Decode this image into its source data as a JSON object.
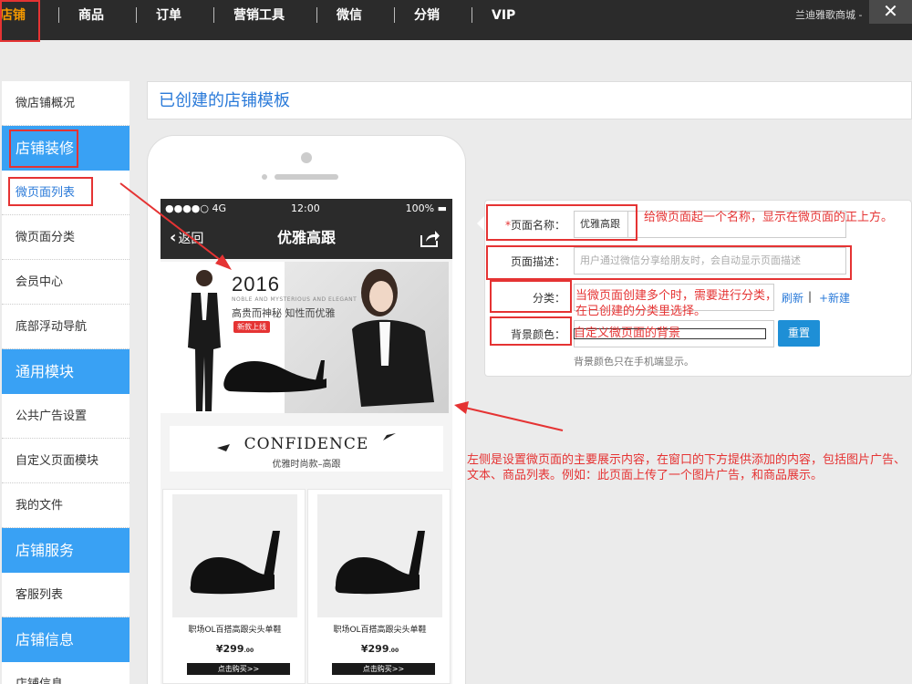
{
  "nav": {
    "items": [
      "店铺",
      "商品",
      "订单",
      "营销工具",
      "微信",
      "分销",
      "VIP"
    ],
    "shop_name": "兰迪雅歌商城 - ",
    "close": "✕"
  },
  "sidebar": {
    "overview": "微店铺概况",
    "sections": [
      {
        "head": "店铺装修",
        "items": [
          "微页面列表",
          "微页面分类",
          "会员中心",
          "底部浮动导航"
        ]
      },
      {
        "head": "通用模块",
        "items": [
          "公共广告设置",
          "自定义页面模块",
          "我的文件"
        ]
      },
      {
        "head": "店铺服务",
        "items": [
          "客服列表"
        ]
      },
      {
        "head": "店铺信息",
        "items": [
          "店铺信息"
        ]
      }
    ]
  },
  "header": {
    "title": "已创建的店铺模板"
  },
  "phone": {
    "status_left": "●●●●○ 4G",
    "status_time": "12:00",
    "status_right": "100% ▬",
    "back_label": "返回",
    "page_title": "优雅高跟",
    "banner": {
      "year": "2016",
      "en": "NOBLE AND MYSTERIOUS AND ELEGANT",
      "cn": "高贵而神秘 知性而优雅",
      "tag": "新款上线"
    },
    "confidence": {
      "en": "CONFIDENCE",
      "cn": "优雅时尚款–高跟"
    },
    "products": [
      {
        "name": "职场OL百搭高跟尖头单鞋",
        "price": "¥299",
        "cents": ".00",
        "buy": "点击购买>>"
      },
      {
        "name": "职场OL百搭高跟尖头单鞋",
        "price": "¥299",
        "cents": ".00",
        "buy": "点击购买>>"
      }
    ]
  },
  "form": {
    "name_label": "页面名称：",
    "name_required": "*",
    "name_value": "优雅高跟",
    "desc_label": "页面描述：",
    "desc_placeholder": "用户通过微信分享给朋友时，会自动显示页面描述",
    "category_label": "分类：",
    "refresh": "刷新",
    "new": "+新建",
    "bg_label": "背景颜色：",
    "reset": "重置",
    "bg_help": "背景颜色只在手机端显示。"
  },
  "annotations": {
    "name_note": "给微页面起一个名称，显示在微页面的正上方。",
    "category_note": "当微页面创建多个时，需要进行分类，在已创建的分类里选择。",
    "bg_note": "自定义微页面的背景",
    "left_note": "左侧是设置微页面的主要展示内容，在窗口的下方提供添加的内容，包括图片广告、文本、商品列表。例如：此页面上传了一个图片广告，和商品展示。"
  },
  "colors": {
    "accent": "#39a1f4",
    "nav_bg": "#2b2b2b",
    "annotation": "#e53333",
    "button": "#1e8fd6"
  }
}
